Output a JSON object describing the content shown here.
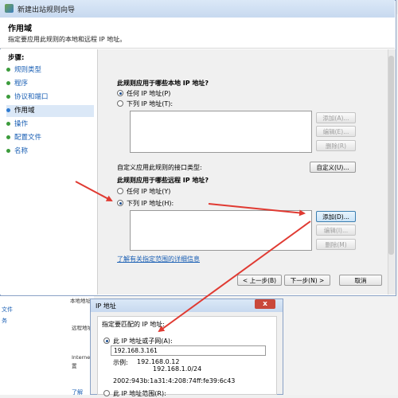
{
  "background": {
    "left_items": [
      "文件",
      "务"
    ],
    "mid_labels": [
      "本地地址",
      "远程地址",
      "Interne",
      "置",
      "了解"
    ]
  },
  "wizard": {
    "title": "新建出站规则向导",
    "page_title": "作用域",
    "page_subtitle": "指定要应用此规则的本地和远程 IP 地址。",
    "steps_title": "步骤:",
    "steps": [
      {
        "label": "规则类型",
        "active": false
      },
      {
        "label": "程序",
        "active": false
      },
      {
        "label": "协议和端口",
        "active": false
      },
      {
        "label": "作用域",
        "active": true
      },
      {
        "label": "操作",
        "active": false
      },
      {
        "label": "配置文件",
        "active": false
      },
      {
        "label": "名称",
        "active": false
      }
    ],
    "local": {
      "heading": "此规则应用于哪些本地 IP 地址?",
      "option_any": "任何 IP 地址(P)",
      "option_list": "下列 IP 地址(T):",
      "selected": "any",
      "buttons": {
        "add": "添加(A)...",
        "edit": "编辑(E)...",
        "delete": "删除(R)"
      }
    },
    "interface": {
      "label": "自定义应用此规则的接口类型:",
      "button": "自定义(U)..."
    },
    "remote": {
      "heading": "此规则应用于哪些远程 IP 地址?",
      "option_any": "任何 IP 地址(Y)",
      "option_list": "下列 IP 地址(H):",
      "selected": "list",
      "buttons": {
        "add": "添加(D)...",
        "edit": "编辑(I)...",
        "delete": "删除(M)"
      }
    },
    "learn_link": "了解有关指定范围的详细信息",
    "nav": {
      "back": "< 上一步(B)",
      "next": "下一步(N) >",
      "cancel": "取消"
    }
  },
  "ip_dialog": {
    "title": "IP 地址",
    "close": "x",
    "prompt": "指定要匹配的 IP 地址:",
    "option_this": "此 IP 地址或子网(A):",
    "value": "192.168.3.161",
    "example_label": "示例:",
    "example_1": "192.168.0.12",
    "example_2": "192.168.1.0/24",
    "example_3": "2002:943b:1a31:4:208:74ff:fe39:6c43",
    "option_range": "此 IP 地址范围(R):"
  },
  "colors": {
    "arrow": "#e03a32",
    "link": "#1a5fb4",
    "step_dot": "#3c9b3c"
  }
}
